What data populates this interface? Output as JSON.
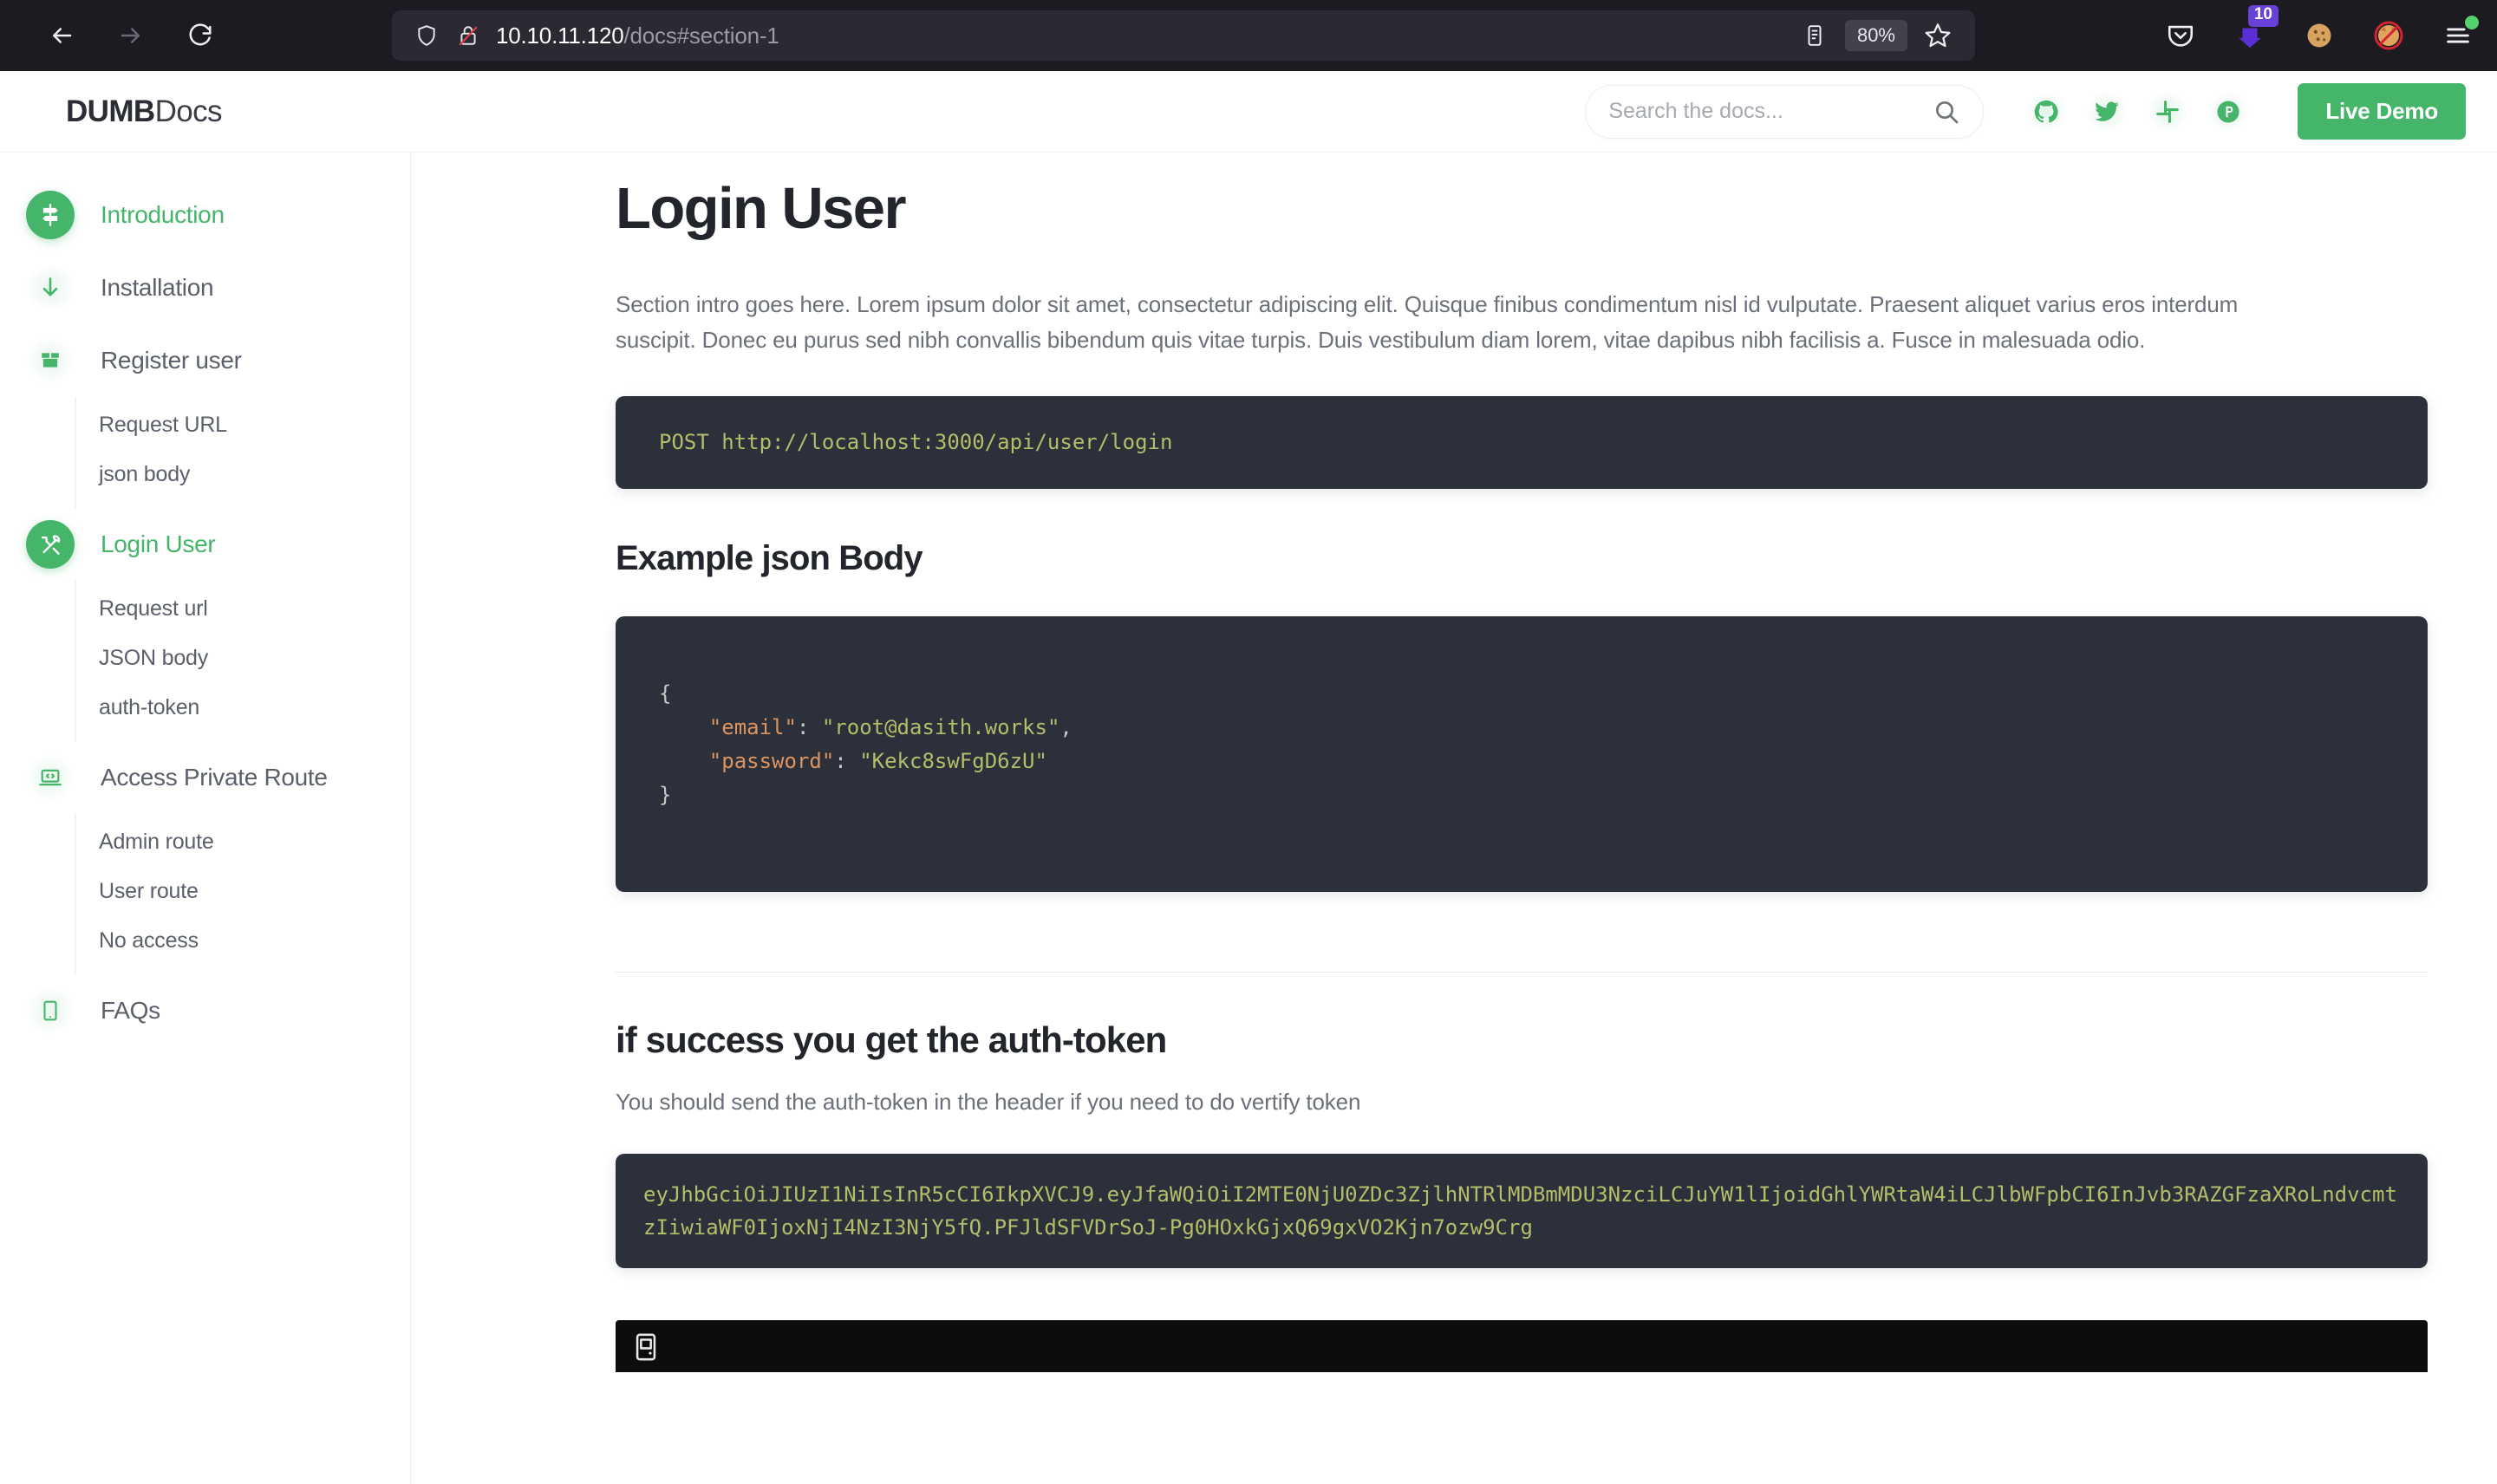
{
  "browser": {
    "back_icon": "back-arrow-icon",
    "forward_icon": "forward-arrow-icon",
    "reload_icon": "reload-icon",
    "url_host": "10.10.11.120",
    "url_path": "/docs#section-1",
    "shield_icon": "tracking-protection-shield-icon",
    "insecure_icon": "insecure-connection-lock-icon",
    "reader_icon": "reader-view-icon",
    "zoom_level": "80%",
    "bookmark_icon": "bookmark-star-icon",
    "pocket_icon": "pocket-icon",
    "extension_badge": "10",
    "extension_icon": "purple-download-extension-icon",
    "cookie_icon": "cookie-extension-icon",
    "fox_blocked_icon": "fox-blocked-extension-icon",
    "menu_icon": "hamburger-menu-icon"
  },
  "header": {
    "logo_bold": "DUMB",
    "logo_light": "Docs",
    "search_placeholder": "Search the docs...",
    "search_value": "",
    "search_icon": "search-icon",
    "socials": [
      {
        "name": "github-icon",
        "label": "GitHub"
      },
      {
        "name": "twitter-icon",
        "label": "Twitter"
      },
      {
        "name": "slack-icon",
        "label": "Slack"
      },
      {
        "name": "producthunt-icon",
        "label": "Product Hunt"
      }
    ],
    "live_demo_label": "Live Demo",
    "accent_color": "#45b56a"
  },
  "sidebar": {
    "groups": [
      {
        "label": "Introduction",
        "icon": "signpost-icon",
        "active": true,
        "filled": true,
        "children": []
      },
      {
        "label": "Installation",
        "icon": "download-arrow-icon",
        "active": false,
        "filled": false,
        "children": []
      },
      {
        "label": "Register user",
        "icon": "package-box-icon",
        "active": false,
        "filled": false,
        "children": [
          "Request URL",
          "json body"
        ]
      },
      {
        "label": "Login User",
        "icon": "tools-icon",
        "active": true,
        "filled": true,
        "children": [
          "Request url",
          "JSON body",
          "auth-token"
        ]
      },
      {
        "label": "Access Private Route",
        "icon": "laptop-code-icon",
        "active": false,
        "filled": false,
        "children": [
          "Admin route",
          "User route",
          "No access"
        ]
      },
      {
        "label": "FAQs",
        "icon": "tablet-icon",
        "active": false,
        "filled": false,
        "children": []
      }
    ]
  },
  "main": {
    "title": "Login User",
    "intro": "Section intro goes here. Lorem ipsum dolor sit amet, consectetur adipiscing elit. Quisque finibus condimentum nisl id vulputate. Praesent aliquet varius eros interdum suscipit. Donec eu purus sed nibh convallis bibendum quis vitae turpis. Duis vestibulum diam lorem, vitae dapibus nibh facilisis a. Fusce in malesuada odio.",
    "request_code": "POST http://localhost:3000/api/user/login",
    "json_heading": "Example json Body",
    "json_body": {
      "open_brace": "{",
      "close_brace": "}",
      "lines": [
        {
          "key": "\"email\"",
          "value": "\"root@dasith.works\"",
          "trailing": ","
        },
        {
          "key": "\"password\"",
          "value": "\"Kekc8swFgD6zU\"",
          "trailing": ""
        }
      ]
    },
    "token_heading": "if success you get the auth-token",
    "token_sub": "You should send the auth-token in the header if you need to do vertify token",
    "token_value": "eyJhbGciOiJIUzI1NiIsInR5cCI6IkpXVCJ9.eyJfaWQiOiI2MTE0NjU0ZDc3ZjlhNTRlMDBmMDU3NzciLCJuYW1lIjoidGhlYWRtaW4iLCJlbWFpbCI6InJvb3RAZGFzaXRoLndvcmtzIiwiaWF0IjoxNjI4NzI3NjY5fQ.PFJldSFVDrSoJ-Pg0HOxkGjxQ69gxVO2Kjn7ozw9Crg",
    "terminal_icon": "terminal-window-icon"
  }
}
